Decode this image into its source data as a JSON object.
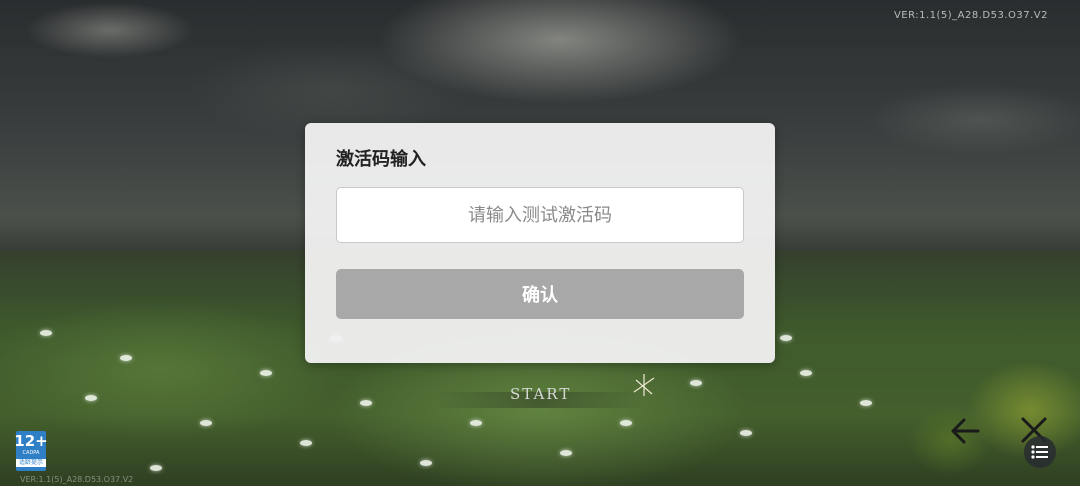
{
  "version_top": "VER:1.1(5)_A28.D53.O37.V2",
  "version_bottom": "VER:1.1(5)_A28.D53.O37.V2",
  "age_rating": {
    "age": "12+",
    "org": "CADPA",
    "tip": "适龄提示"
  },
  "start_label": "START",
  "dialog": {
    "title": "激活码输入",
    "input_value": "",
    "input_placeholder": "请输入测试激活码",
    "confirm_label": "确认"
  },
  "icons": {
    "back": "arrow-left-icon",
    "close": "close-icon",
    "menu": "menu-list-icon",
    "start_deco": "star-sparkle-icon"
  },
  "colors": {
    "dialog_bg": "#f0f0f0",
    "confirm_disabled": "#a8a8a8",
    "age_badge": "#2f7fc7"
  }
}
